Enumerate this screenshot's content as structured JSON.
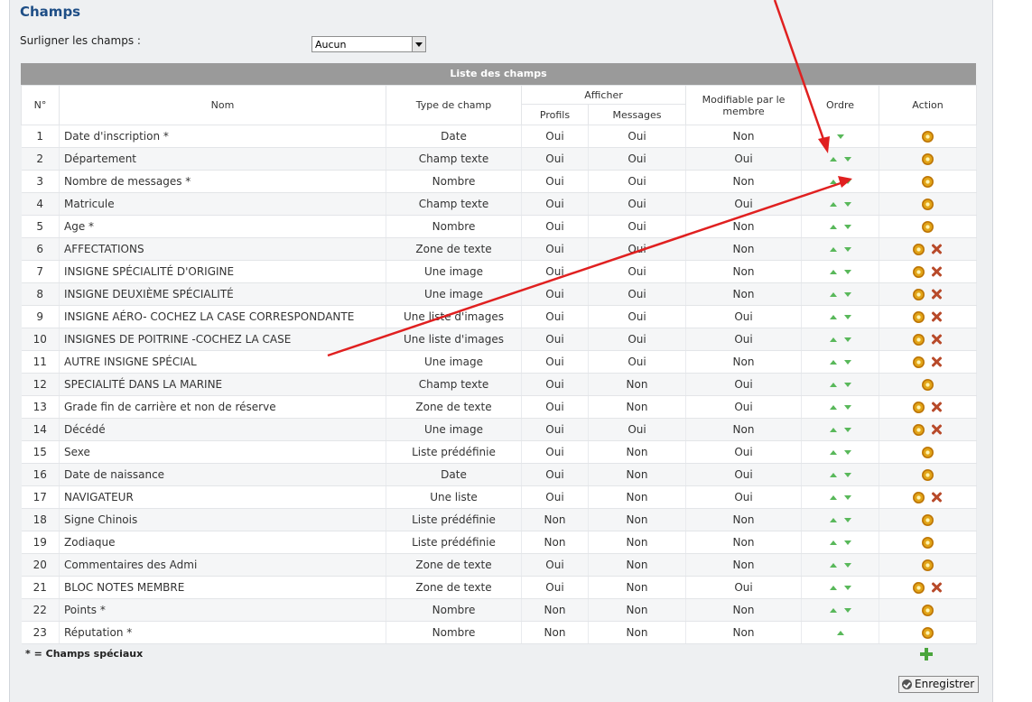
{
  "section_title": "Champs",
  "highlight": {
    "label": "Surligner les champs :",
    "selected": "Aucun"
  },
  "list_title": "Liste des champs",
  "columns": {
    "num": "N°",
    "name": "Nom",
    "type": "Type de champ",
    "display": "Afficher",
    "profiles": "Profils",
    "messages": "Messages",
    "editable": "Modifiable par le membre",
    "order": "Ordre",
    "action": "Action"
  },
  "rows": [
    {
      "n": "1",
      "name": "Date d'inscription *",
      "type": "Date",
      "profils": "Oui",
      "messages": "Oui",
      "editable": "Non",
      "up": false,
      "down": true,
      "del": false
    },
    {
      "n": "2",
      "name": "Département",
      "type": "Champ texte",
      "profils": "Oui",
      "messages": "Oui",
      "editable": "Oui",
      "up": true,
      "down": true,
      "del": false
    },
    {
      "n": "3",
      "name": "Nombre de messages *",
      "type": "Nombre",
      "profils": "Oui",
      "messages": "Oui",
      "editable": "Non",
      "up": true,
      "down": true,
      "del": false
    },
    {
      "n": "4",
      "name": "Matricule",
      "type": "Champ texte",
      "profils": "Oui",
      "messages": "Oui",
      "editable": "Oui",
      "up": true,
      "down": true,
      "del": false
    },
    {
      "n": "5",
      "name": "Age *",
      "type": "Nombre",
      "profils": "Oui",
      "messages": "Oui",
      "editable": "Non",
      "up": true,
      "down": true,
      "del": false
    },
    {
      "n": "6",
      "name": "AFFECTATIONS",
      "type": "Zone de texte",
      "profils": "Oui",
      "messages": "Oui",
      "editable": "Non",
      "up": true,
      "down": true,
      "del": true
    },
    {
      "n": "7",
      "name": "INSIGNE SPÉCIALITÉ D'ORIGINE",
      "type": "Une image",
      "profils": "Oui",
      "messages": "Oui",
      "editable": "Non",
      "up": true,
      "down": true,
      "del": true
    },
    {
      "n": "8",
      "name": "INSIGNE DEUXIÈME SPÉCIALITÉ",
      "type": "Une image",
      "profils": "Oui",
      "messages": "Oui",
      "editable": "Non",
      "up": true,
      "down": true,
      "del": true
    },
    {
      "n": "9",
      "name": "INSIGNE AÉRO- COCHEZ LA CASE CORRESPONDANTE",
      "type": "Une liste d'images",
      "profils": "Oui",
      "messages": "Oui",
      "editable": "Oui",
      "up": true,
      "down": true,
      "del": true
    },
    {
      "n": "10",
      "name": "INSIGNES DE POITRINE -COCHEZ LA CASE",
      "type": "Une liste d'images",
      "profils": "Oui",
      "messages": "Oui",
      "editable": "Oui",
      "up": true,
      "down": true,
      "del": true
    },
    {
      "n": "11",
      "name": "AUTRE INSIGNE SPÉCIAL",
      "type": "Une image",
      "profils": "Oui",
      "messages": "Oui",
      "editable": "Non",
      "up": true,
      "down": true,
      "del": true
    },
    {
      "n": "12",
      "name": "SPECIALITÉ DANS LA MARINE",
      "type": "Champ texte",
      "profils": "Oui",
      "messages": "Non",
      "editable": "Oui",
      "up": true,
      "down": true,
      "del": false
    },
    {
      "n": "13",
      "name": "Grade fin de carrière et non de réserve",
      "type": "Zone de texte",
      "profils": "Oui",
      "messages": "Non",
      "editable": "Oui",
      "up": true,
      "down": true,
      "del": true
    },
    {
      "n": "14",
      "name": "Décédé",
      "type": "Une image",
      "profils": "Oui",
      "messages": "Oui",
      "editable": "Non",
      "up": true,
      "down": true,
      "del": true
    },
    {
      "n": "15",
      "name": "Sexe",
      "type": "Liste prédéfinie",
      "profils": "Oui",
      "messages": "Non",
      "editable": "Oui",
      "up": true,
      "down": true,
      "del": false
    },
    {
      "n": "16",
      "name": "Date de naissance",
      "type": "Date",
      "profils": "Oui",
      "messages": "Non",
      "editable": "Oui",
      "up": true,
      "down": true,
      "del": false
    },
    {
      "n": "17",
      "name": "NAVIGATEUR",
      "type": "Une liste",
      "profils": "Oui",
      "messages": "Non",
      "editable": "Oui",
      "up": true,
      "down": true,
      "del": true
    },
    {
      "n": "18",
      "name": "Signe Chinois",
      "type": "Liste prédéfinie",
      "profils": "Non",
      "messages": "Non",
      "editable": "Non",
      "up": true,
      "down": true,
      "del": false
    },
    {
      "n": "19",
      "name": "Zodiaque",
      "type": "Liste prédéfinie",
      "profils": "Non",
      "messages": "Non",
      "editable": "Non",
      "up": true,
      "down": true,
      "del": false
    },
    {
      "n": "20",
      "name": "Commentaires des Admi",
      "type": "Zone de texte",
      "profils": "Oui",
      "messages": "Non",
      "editable": "Non",
      "up": true,
      "down": true,
      "del": false
    },
    {
      "n": "21",
      "name": "BLOC NOTES MEMBRE",
      "type": "Zone de texte",
      "profils": "Oui",
      "messages": "Non",
      "editable": "Oui",
      "up": true,
      "down": true,
      "del": true
    },
    {
      "n": "22",
      "name": "Points *",
      "type": "Nombre",
      "profils": "Non",
      "messages": "Non",
      "editable": "Non",
      "up": true,
      "down": true,
      "del": false
    },
    {
      "n": "23",
      "name": "Réputation *",
      "type": "Nombre",
      "profils": "Non",
      "messages": "Non",
      "editable": "Non",
      "up": true,
      "down": false,
      "del": false
    }
  ],
  "footer": {
    "special_note": "* = Champs spéciaux",
    "save_label": "Enregistrer"
  },
  "icons": {
    "order_up": "green-up-arrow-icon",
    "order_down": "green-down-arrow-icon",
    "edit": "gear-edit-icon",
    "delete": "red-x-delete-icon",
    "add": "green-plus-icon",
    "save": "check-circle-icon"
  },
  "colors": {
    "title": "#1e4e86",
    "header_bar": "#9a9a9a",
    "order_arrow": "#59b85a",
    "delete": "#b84a2a",
    "annotation_arrow": "#e02020"
  }
}
